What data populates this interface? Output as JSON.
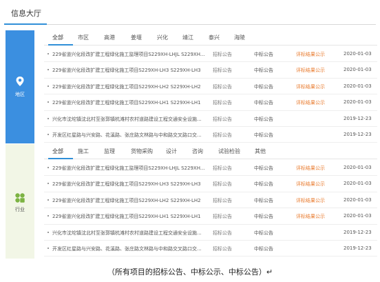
{
  "header": {
    "title": "信息大厅"
  },
  "region_section": {
    "side_label": "地区",
    "icon": "location-pin-icon",
    "tabs": [
      "全部",
      "市区",
      "高港",
      "姜堰",
      "兴化",
      "靖江",
      "泰兴",
      "海陵"
    ],
    "active_tab": "全部",
    "rows": [
      {
        "title": "229省道兴化段改扩建工程绿化施工监理项目S229XH-LHJL  S229XH...",
        "type": "招标公告",
        "stage": "中标公告",
        "status": "评标结果公示",
        "date": "2020-01-03"
      },
      {
        "title": "229省道兴化段改扩建工程绿化施工项目S229XH-LH3  S229XH-LH3",
        "type": "招标公告",
        "stage": "中标公告",
        "status": "评标结果公示",
        "date": "2020-01-03"
      },
      {
        "title": "229省道兴化段改扩建工程绿化施工项目S229XH-LH2  S229XH-LH2",
        "type": "招标公告",
        "stage": "中标公告",
        "status": "评标结果公示",
        "date": "2020-01-03"
      },
      {
        "title": "229省道兴化段改扩建工程绿化施工项目S229XH-LH1  S229XH-LH1",
        "type": "招标公告",
        "stage": "中标公告",
        "status": "评标结果公示",
        "date": "2020-01-03"
      },
      {
        "title": "兴化市沈坨镇沈北村至张郭镇杭滩村农村道路建设工程交通安全设施...",
        "type": "招标公告",
        "stage": "中标公告",
        "status": "",
        "date": "2019-12-23"
      },
      {
        "title": "开发区红星路与兴安路、花溪路、张庄路文林路与中和路交叉路口交...",
        "type": "招标公告",
        "stage": "中标公告",
        "status": "",
        "date": "2019-12-23"
      }
    ]
  },
  "industry_section": {
    "side_label": "行业",
    "icon": "grid-leaf-icon",
    "tabs": [
      "全部",
      "施工",
      "监理",
      "货物采购",
      "设计",
      "咨询",
      "试验检验",
      "其他"
    ],
    "active_tab": "全部",
    "rows": [
      {
        "title": "229省道兴化段改扩建工程绿化施工监理项目S229XH-LHJL  S229XH...",
        "type": "招标公告",
        "stage": "中标公告",
        "status": "评标结果公示",
        "date": "2020-01-03"
      },
      {
        "title": "229省道兴化段改扩建工程绿化施工项目S229XH-LH3  S229XH-LH3",
        "type": "招标公告",
        "stage": "中标公告",
        "status": "评标结果公示",
        "date": "2020-01-03"
      },
      {
        "title": "229省道兴化段改扩建工程绿化施工项目S229XH-LH2  S229XH-LH2",
        "type": "招标公告",
        "stage": "中标公告",
        "status": "评标结果公示",
        "date": "2020-01-03"
      },
      {
        "title": "229省道兴化段改扩建工程绿化施工项目S229XH-LH1  S229XH-LH1",
        "type": "招标公告",
        "stage": "中标公告",
        "status": "评标结果公示",
        "date": "2020-01-03"
      },
      {
        "title": "兴化市沈坨镇沈北村至张郭镇杭滩村农村道路建设工程交通安全设施...",
        "type": "招标公告",
        "stage": "中标公告",
        "status": "",
        "date": "2019-12-23"
      },
      {
        "title": "开发区红星路与兴安路、花溪路、张庄路文林路与中和路交叉路口交...",
        "type": "招标公告",
        "stage": "中标公告",
        "status": "",
        "date": "2019-12-23"
      }
    ]
  },
  "caption": "（所有项目的招标公告、中标公示、中标公告）↵",
  "colors": {
    "accent": "#2f8fd8",
    "region_side": "#3b8fe0",
    "industry_side": "#f2f6e6",
    "status": "#e8782a",
    "industry_icon": "#7cb342"
  }
}
